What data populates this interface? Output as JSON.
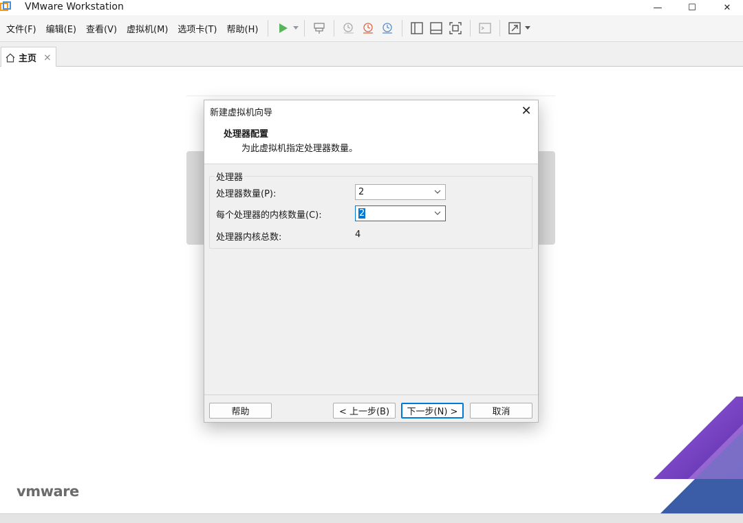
{
  "window": {
    "title": "VMware Workstation",
    "minimize_glyph": "—",
    "maximize_glyph": "☐",
    "close_glyph": "✕"
  },
  "menu": {
    "items": [
      "文件(F)",
      "编辑(E)",
      "查看(V)",
      "虚拟机(M)",
      "选项卡(T)",
      "帮助(H)"
    ]
  },
  "tabs": [
    {
      "label": "主页",
      "icon": "home-icon",
      "close_glyph": "×"
    }
  ],
  "dialog": {
    "title": "新建虚拟机向导",
    "close_glyph": "✕",
    "heading": "处理器配置",
    "subheading": "为此虚拟机指定处理器数量。",
    "group_label": "处理器",
    "processor_count_label": "处理器数量(P):",
    "processor_count_value": "2",
    "cores_per_processor_label": "每个处理器的内核数量(C):",
    "cores_per_processor_value": "2",
    "total_cores_label": "处理器内核总数:",
    "total_cores_value": "4",
    "buttons": {
      "help": "帮助",
      "back": "< 上一步(B)",
      "next": "下一步(N) >",
      "cancel": "取消"
    }
  },
  "branding": {
    "logo_text": "vmware"
  },
  "colors": {
    "accent": "#0078d7",
    "play_green": "#5ab45a",
    "brand_purple": "#7b3fbf",
    "brand_blue": "#1d4fa8"
  }
}
